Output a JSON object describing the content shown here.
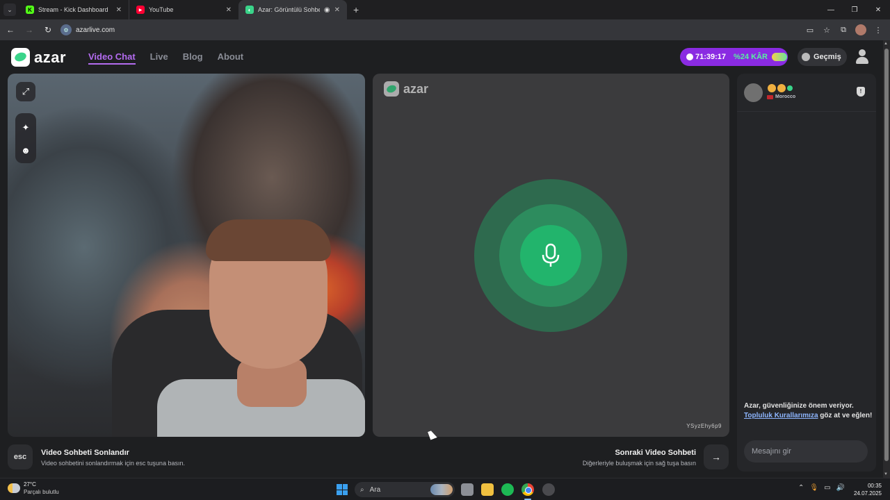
{
  "browser": {
    "tabs": [
      {
        "label": "Stream - Kick Dashboard",
        "icon": "kick-icon"
      },
      {
        "label": "YouTube",
        "icon": "youtube-icon"
      },
      {
        "label": "Azar: Görüntülü Sohbet, Art",
        "icon": "azar-icon"
      }
    ],
    "url": "azarlive.com"
  },
  "site": {
    "logo_text": "azar",
    "nav": [
      "Video Chat",
      "Live",
      "Blog",
      "About"
    ],
    "timer": "71:39:17",
    "discount": "%24 KÂR",
    "history_label": "Geçmiş"
  },
  "partner": {
    "logo_text": "azar",
    "id": "YSyzEhy6p9",
    "country": "Morocco"
  },
  "chat": {
    "notice_pre": "Azar, güvenliğinize önem veriyor.",
    "notice_link": "Topluluk Kurallarımıza",
    "notice_post": "göz at ve eğlen!",
    "input_placeholder": "Mesajını gir"
  },
  "controls": {
    "esc_key": "esc",
    "end_title": "Video Sohbeti Sonlandır",
    "end_sub": "Video sohbetini sonlandırmak için esc tuşuna basın.",
    "next_title": "Sonraki Video Sohbeti",
    "next_sub": "Diğerleriyle buluşmak için sağ tuşa basın"
  },
  "taskbar": {
    "temp": "27°C",
    "condition": "Parçalı bulutlu",
    "search_placeholder": "Ara",
    "time": "00:35",
    "date": "24.07.2025"
  },
  "colors": {
    "accent_purple": "#b46cf0",
    "timer_pill": "#8a2be2",
    "mic_green": "#22b46c"
  }
}
